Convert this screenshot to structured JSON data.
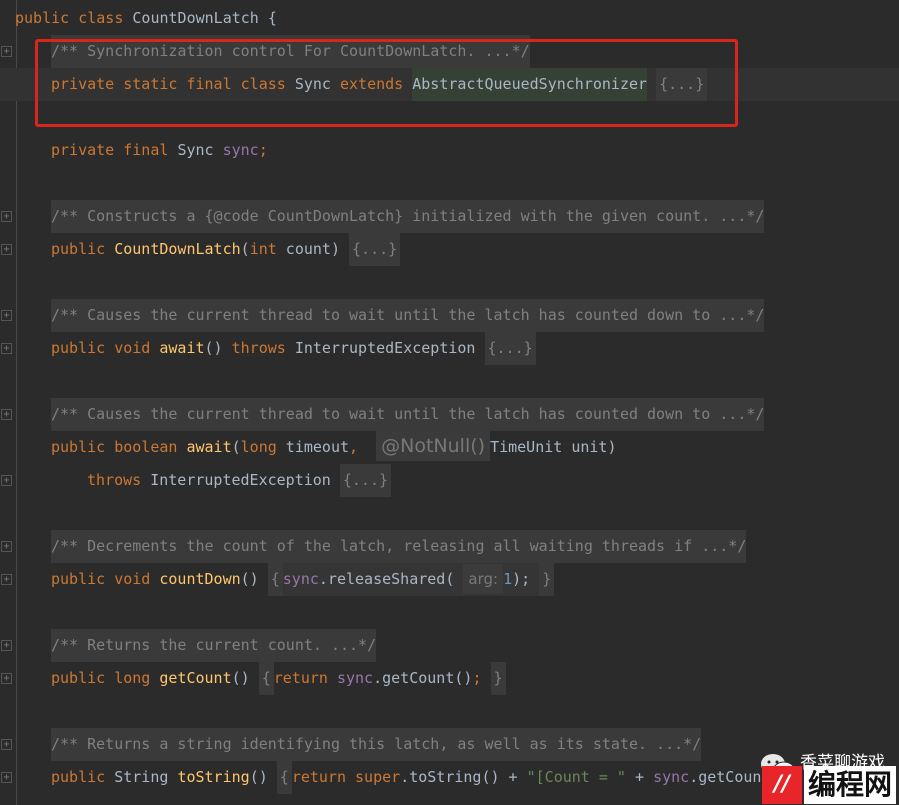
{
  "editor": {
    "class_decl": {
      "kw_public": "public",
      "kw_class": "class",
      "name": "CountDownLatch",
      "brace": "{"
    },
    "sync_class": {
      "doc": "/** Synchronization control For CountDownLatch. ...*/",
      "kw_private": "private",
      "kw_static": "static",
      "kw_final": "final",
      "kw_class": "class",
      "name": "Sync",
      "kw_extends": "extends",
      "super": "AbstractQueuedSynchronizer",
      "folded": "{...}"
    },
    "field": {
      "kw_private": "private",
      "kw_final": "final",
      "type": "Sync",
      "name": "sync",
      "semi": ";"
    },
    "constructor": {
      "doc": "/** Constructs a {@code CountDownLatch} initialized with the given count. ...*/",
      "kw_public": "public",
      "name": "CountDownLatch",
      "open": "(",
      "kw_int": "int",
      "param": " count",
      "close": ")",
      "folded": "{...}"
    },
    "await1": {
      "doc": "/** Causes the current thread to wait until the latch has counted down to ...*/",
      "kw_public": "public",
      "kw_void": "void",
      "name": "await",
      "parens": "()",
      "kw_throws": "throws",
      "exception": "InterruptedException",
      "folded": "{...}"
    },
    "await2": {
      "doc": "/** Causes the current thread to wait until the latch has counted down to ...*/",
      "kw_public": "public",
      "kw_boolean": "boolean",
      "name": "await",
      "open": "(",
      "kw_long": "long",
      "param1": " timeout",
      "comma": ",",
      "hint": "@NotNull()",
      "param2": "TimeUnit unit)",
      "kw_throws": "throws",
      "exception": "InterruptedException",
      "folded": "{...}"
    },
    "countdown": {
      "doc": "/** Decrements the count of the latch, releasing all waiting threads if ...*/",
      "kw_public": "public",
      "kw_void": "void",
      "name": "countDown",
      "parens": "()",
      "open_brace": "{",
      "field": "sync",
      "call": ".releaseShared(",
      "hint": "arg:",
      "num": "1",
      "close": ");",
      "close_brace": "}"
    },
    "getcount": {
      "doc": "/** Returns the current count. ...*/",
      "kw_public": "public",
      "kw_long": "long",
      "name": "getCount",
      "parens": "()",
      "open_brace": "{",
      "kw_return": "return",
      "field": "sync",
      "call": ".getCount()",
      "semi": ";",
      "close_brace": "}"
    },
    "tostring": {
      "doc": "/** Returns a string identifying this latch, as well as its state. ...*/",
      "kw_public": "public",
      "type": "String",
      "name": "toString",
      "parens": "()",
      "open_brace": "{",
      "kw_return": "return",
      "kw_super": "super",
      "call": ".toString() + ",
      "str": "\"[Count = \"",
      "plus": " + ",
      "field": "sync",
      "call2": ".getCount"
    }
  },
  "watermark": {
    "title": "香菜聊游戏",
    "logo_mark": "//",
    "logo_text": "编程网"
  },
  "colors": {
    "keyword": "#cc7832",
    "method": "#ffc66d",
    "field": "#9876aa",
    "number": "#6897bb",
    "string": "#6a8759",
    "comment": "#808080",
    "background": "#2b2b2b",
    "highlight_box": "#d9261c"
  }
}
